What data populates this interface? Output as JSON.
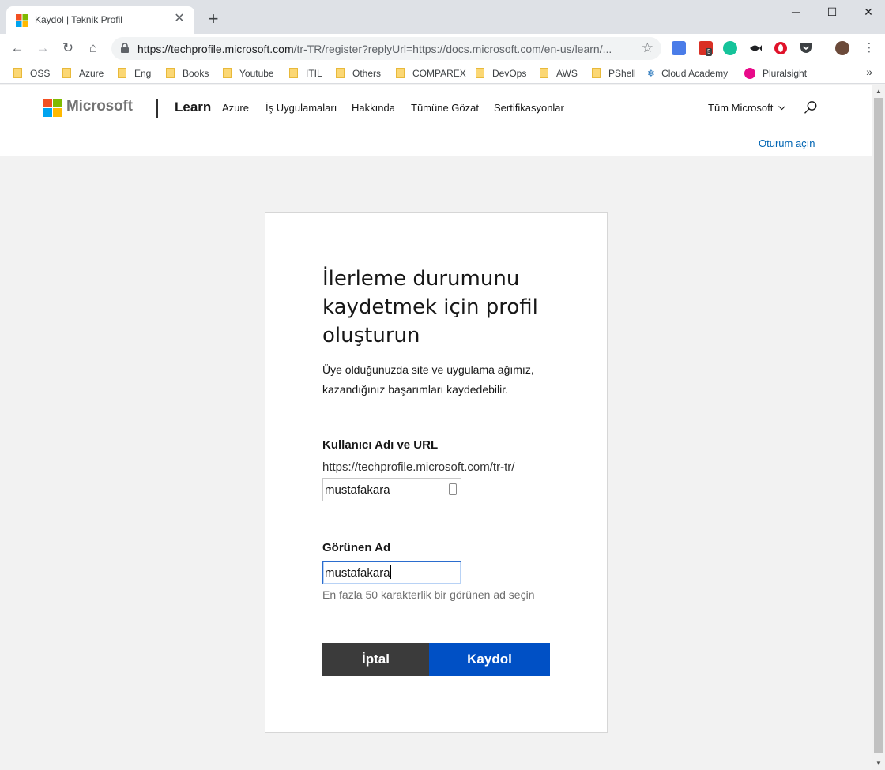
{
  "browser": {
    "tab_title": "Kaydol | Teknik Profil",
    "url_host": "https://techprofile.microsoft.com",
    "url_path": "/tr-TR/register?replyUrl=https://docs.microsoft.com/en-us/learn/...",
    "bookmarks": [
      "OSS",
      "Azure",
      "Eng",
      "Books",
      "Youtube",
      "ITIL",
      "Others",
      "COMPAREX",
      "DevOps",
      "AWS",
      "PShell",
      "Cloud Academy",
      "Pluralsight"
    ],
    "more_bookmarks": "»",
    "ext_badge": "5"
  },
  "header": {
    "brand": "Microsoft",
    "product": "Learn",
    "nav": [
      "Azure",
      "İş Uygulamaları",
      "Hakkında",
      "Tümüne Gözat",
      "Sertifikasyonlar"
    ],
    "all_microsoft": "Tüm Microsoft"
  },
  "subbar": {
    "signin": "Oturum açın"
  },
  "form": {
    "title": "İlerleme durumunu kaydetmek için profil oluşturun",
    "intro": "Üye olduğunuzda site ve uygulama ağımız, kazandığınız başarımları kaydedebilir.",
    "username_label": "Kullanıcı Adı ve URL",
    "url_prefix": "https://techprofile.microsoft.com/tr-tr/",
    "username_value": "mustafakara",
    "display_label": "Görünen Ad",
    "display_value": "mustafakara",
    "display_hint": "En fazla 50 karakterlik bir görünen ad seçin",
    "cancel_label": "İptal",
    "save_label": "Kaydol"
  },
  "colors": {
    "accent": "#0050c5",
    "link": "#0065b3",
    "cancel": "#3b3b3b"
  }
}
